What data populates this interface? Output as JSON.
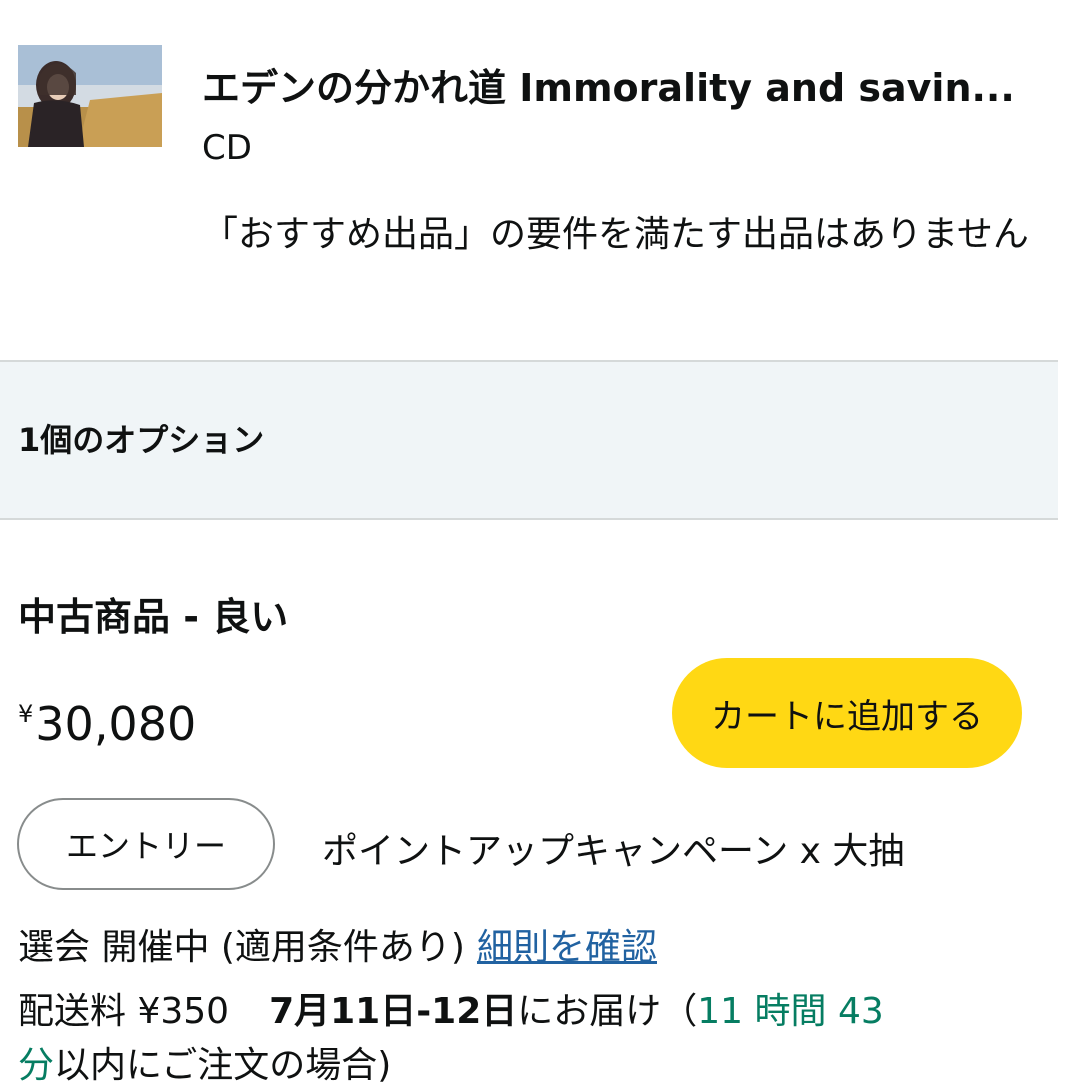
{
  "product": {
    "title": "エデンの分かれ道 Immorality and savin...",
    "format": "CD",
    "notice": "「おすすめ出品」の要件を満たす出品はありません",
    "thumbnail_icon": "album-cover-image"
  },
  "options": {
    "title": "1個のオプション"
  },
  "offer": {
    "condition": "中古商品 - 良い",
    "currency": "¥",
    "price": "30,080",
    "add_to_cart_label": "カートに追加する",
    "entry_label": "エントリー",
    "campaign_line1": "ポイントアップキャンペーン x 大抽",
    "campaign_line2": "選会 開催中 (適用条件あり)",
    "details_link": "細則を確認",
    "shipping_fee": "配送料 ¥350",
    "delivery_date": "7月11日-12日",
    "delivery_suffix": "にお届け（",
    "countdown_line1": "11 時間 43",
    "countdown_line2": "分",
    "order_suffix": "以内にご注文の場合)"
  },
  "colors": {
    "cart_button": "#ffd814",
    "link": "#2162a1",
    "countdown": "#067d62",
    "options_band": "#f0f5f7"
  }
}
